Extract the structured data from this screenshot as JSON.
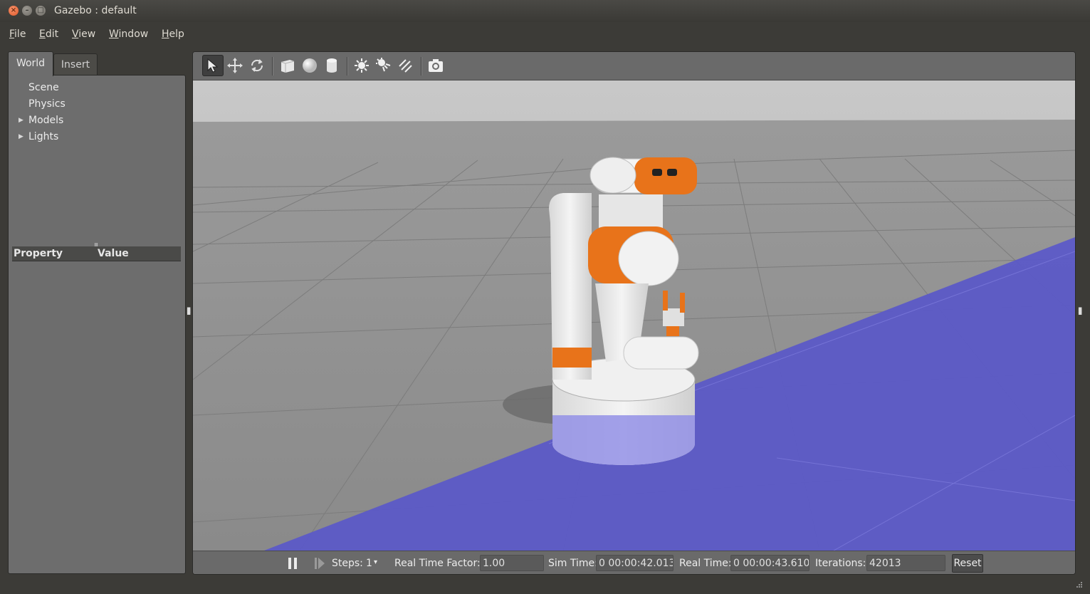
{
  "window": {
    "title": "Gazebo : default",
    "close_glyph": "×",
    "min_glyph": "–",
    "max_glyph": "□"
  },
  "menu": {
    "items": [
      "File",
      "Edit",
      "View",
      "Window",
      "Help"
    ]
  },
  "left_panel": {
    "tabs": [
      "World",
      "Insert"
    ],
    "active_tab": "World",
    "tree": [
      {
        "label": "Scene",
        "expandable": false
      },
      {
        "label": "Physics",
        "expandable": false
      },
      {
        "label": "Models",
        "expandable": true
      },
      {
        "label": "Lights",
        "expandable": true
      }
    ],
    "expand_glyph": "▶",
    "property_header": {
      "property": "Property",
      "value": "Value"
    }
  },
  "toolbar": {
    "tools": [
      "select-arrow-icon",
      "translate-icon",
      "rotate-icon",
      "box-shape-icon",
      "sphere-shape-icon",
      "cylinder-shape-icon",
      "point-light-icon",
      "spot-light-icon",
      "directional-light-icon",
      "screenshot-camera-icon"
    ],
    "active_tool": "select-arrow-icon"
  },
  "bottom_bar": {
    "steps_label": "Steps:",
    "steps_value": "1",
    "real_time_factor_label": "Real Time Factor:",
    "real_time_factor": "1.00",
    "sim_time_label": "Sim Time:",
    "sim_time": "0 00:00:42.013",
    "real_time_label": "Real Time:",
    "real_time": "0 00:00:43.610",
    "iterations_label": "Iterations:",
    "iterations": "42013",
    "reset_label": "Reset"
  },
  "colors": {
    "robot_accent": "#e8731a",
    "ground_plane_highlight": "#5a58c8",
    "panel_bg": "#6d6d6d"
  }
}
